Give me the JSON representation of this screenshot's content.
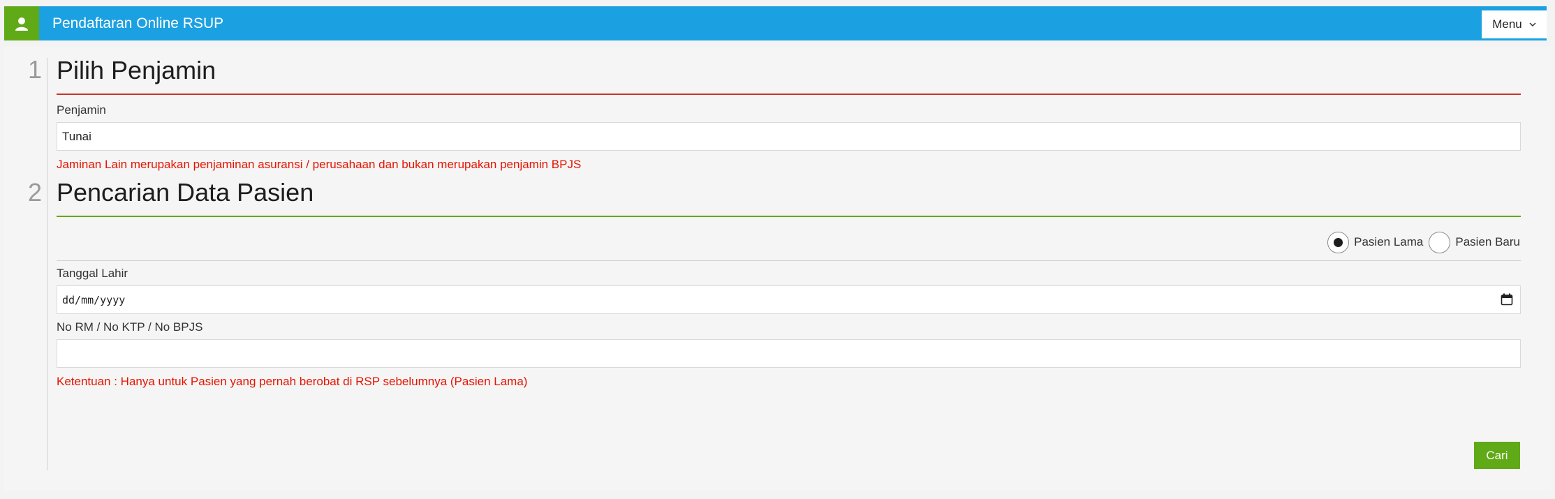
{
  "header": {
    "title": "Pendaftaran Online RSUP",
    "menu_label": "Menu",
    "user_icon": "user-icon",
    "colors": {
      "bar": "#1ba1e2",
      "icon_bg": "#60a917"
    }
  },
  "step1": {
    "number": "1",
    "title": "Pilih Penjamin",
    "field_label": "Penjamin",
    "field_value": "Tunai",
    "note": "Jaminan Lain merupakan penjaminan asuransi / perusahaan dan bukan merupakan penjamin BPJS",
    "rule_color": "#e51400"
  },
  "step2": {
    "number": "2",
    "title": "Pencarian Data Pasien",
    "rule_color": "#60a917",
    "radio_options": [
      {
        "label": "Pasien Lama",
        "selected": true
      },
      {
        "label": "Pasien Baru",
        "selected": false
      }
    ],
    "dob_label": "Tanggal Lahir",
    "dob_placeholder": "dd/mm/yyyy",
    "id_label": "No RM / No KTP / No BPJS",
    "id_value": "",
    "note": "Ketentuan : Hanya untuk Pasien yang pernah berobat di RSP sebelumnya (Pasien Lama)",
    "search_button": "Cari"
  }
}
